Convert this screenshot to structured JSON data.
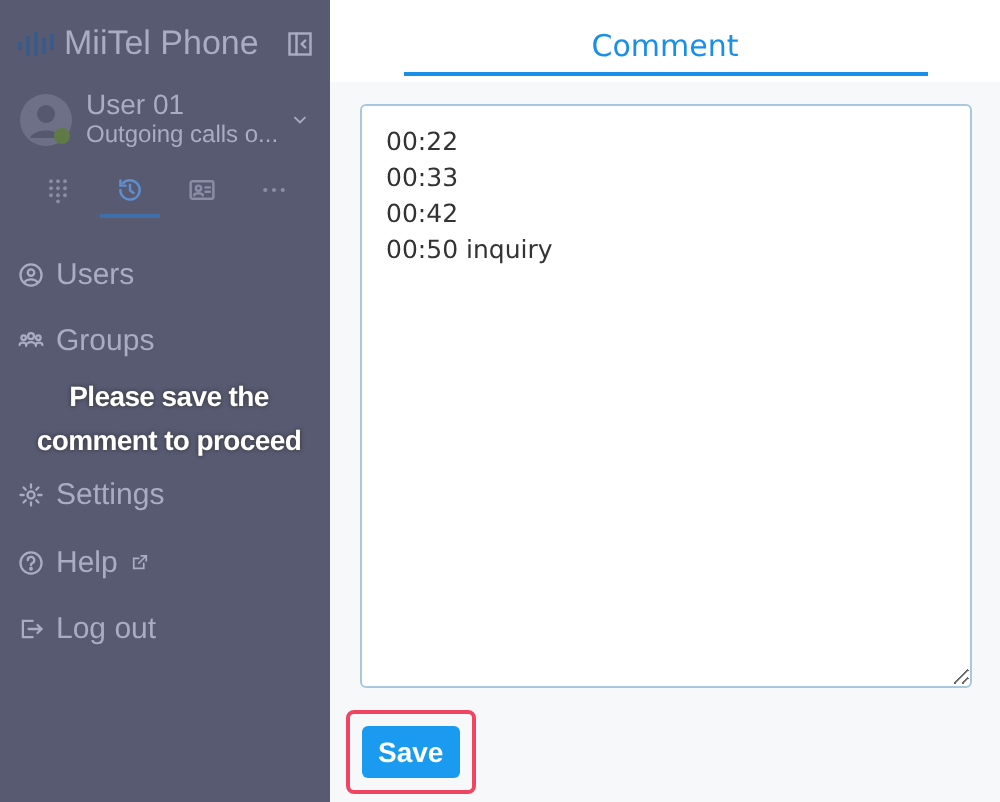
{
  "sidebar": {
    "logo": "MiiTel Phone",
    "user": {
      "name": "User 01",
      "status": "Outgoing calls o..."
    },
    "nav_tabs": [
      {
        "kind": "dialpad",
        "selected": false
      },
      {
        "kind": "history",
        "selected": true
      },
      {
        "kind": "contacts",
        "selected": false
      },
      {
        "kind": "more",
        "selected": false
      }
    ],
    "menu": [
      {
        "kind": "users",
        "label": "Users"
      },
      {
        "kind": "groups",
        "label": "Groups"
      },
      {
        "kind": "notice",
        "label": "Please save the comment to proceed"
      },
      {
        "kind": "settings",
        "label": "Settings"
      },
      {
        "kind": "help",
        "label": "Help",
        "external": true
      },
      {
        "kind": "logout",
        "label": "Log out"
      }
    ]
  },
  "panel": {
    "tabs": [
      {
        "label": "Comment",
        "selected": true
      }
    ],
    "comment": {
      "value": "00:22\n00:33\n00:42\n00:50 inquiry"
    },
    "save_button": {
      "label": "Save",
      "highlighted": true
    }
  }
}
